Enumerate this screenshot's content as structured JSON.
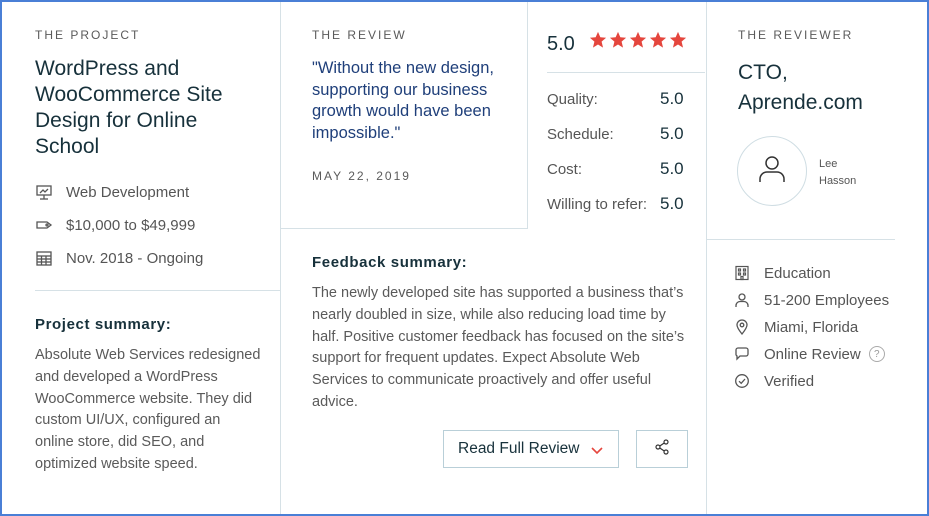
{
  "project": {
    "section_label": "THE PROJECT",
    "title": "WordPress and WooCommerce Site Design for Online School",
    "service": "Web Development",
    "budget": "$10,000 to $49,999",
    "timeline": "Nov. 2018 - Ongoing",
    "summary_heading": "Project summary:",
    "summary_text": "Absolute Web Services redesigned and developed a WordPress WooCommerce website. They did custom UI/UX, configured an online store, did SEO, and optimized website speed."
  },
  "review": {
    "section_label": "THE REVIEW",
    "quote": "\"Without the new design, supporting our business growth would have been impossible.\"",
    "date": "MAY 22, 2019",
    "overall_score": "5.0",
    "star_count": 5,
    "star_color": "#e5463d",
    "ratings": [
      {
        "label": "Quality:",
        "value": "5.0"
      },
      {
        "label": "Schedule:",
        "value": "5.0"
      },
      {
        "label": "Cost:",
        "value": "5.0"
      },
      {
        "label": "Willing to refer:",
        "value": "5.0"
      }
    ],
    "feedback_heading": "Feedback summary:",
    "feedback_text": "The newly developed site has supported a business that’s nearly doubled in size, while also reducing load time by half. Positive customer feedback has focused on the site’s support for frequent updates. Expect Absolute Web Services to communicate proactively and offer useful advice.",
    "read_full_label": "Read Full Review"
  },
  "reviewer": {
    "section_label": "THE REVIEWER",
    "role": "CTO, Aprende.com",
    "first_name": "Lee",
    "last_name": "Hasson",
    "industry": "Education",
    "employees": "51-200 Employees",
    "location": "Miami, Florida",
    "review_type": "Online Review",
    "help_glyph": "?",
    "status": "Verified"
  },
  "colors": {
    "frame_border": "#4a7fd6",
    "accent_red": "#e5463d",
    "quote_blue": "#1f3f7a",
    "divider": "#d6e1e6"
  }
}
